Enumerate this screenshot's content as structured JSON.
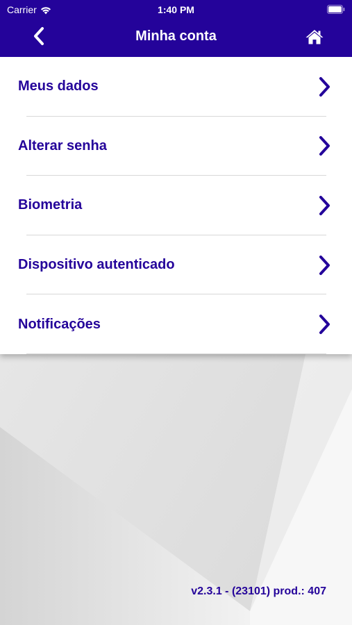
{
  "status_bar": {
    "carrier": "Carrier",
    "time": "1:40 PM"
  },
  "navbar": {
    "title": "Minha conta",
    "back_icon": "chevron-left-icon",
    "home_icon": "home-icon"
  },
  "menu": {
    "items": [
      {
        "label": "Meus dados"
      },
      {
        "label": "Alterar senha"
      },
      {
        "label": "Biometria"
      },
      {
        "label": "Dispositivo autenticado"
      },
      {
        "label": "Notificações"
      }
    ]
  },
  "footer": {
    "version": "v2.3.1 - (23101) prod.: 407"
  },
  "colors": {
    "primary": "#24039a",
    "background": "#e9e9e9",
    "divider": "#d8d8d8"
  }
}
